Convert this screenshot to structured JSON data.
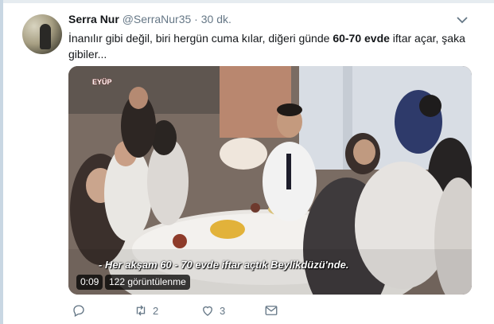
{
  "tweet": {
    "name": "Serra Nur",
    "handle": "@SerraNur35",
    "separator": "·",
    "time": "30 dk.",
    "text_before": "İnanılır gibi değil, biri hergün cuma kılar, diğeri günde ",
    "text_bold": "60-70 evde",
    "text_after": " iftar açar, şaka gibiler..."
  },
  "media": {
    "subtitle": "- Her akşam 60 - 70 evde iftar açtık Beylikdüzü'nde.",
    "watermark": "EYÜP",
    "duration": "0:09",
    "views": "122 görüntülenme"
  },
  "actions": {
    "reply_icon": "reply-icon",
    "retweet_icon": "retweet-icon",
    "retweet_count": "2",
    "like_icon": "heart-icon",
    "like_count": "3",
    "dm_icon": "envelope-icon"
  },
  "colors": {
    "text": "#14171a",
    "secondary": "#657786",
    "frame": "#c9d7e3"
  }
}
